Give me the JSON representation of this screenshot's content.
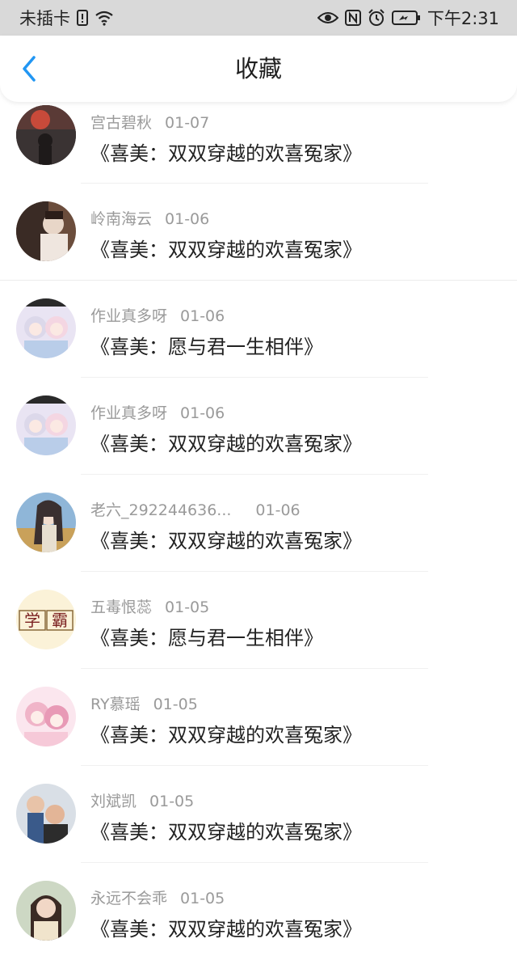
{
  "status_bar": {
    "carrier": "未插卡",
    "time": "下午2:31",
    "icons": [
      "sim-alert-icon",
      "wifi-icon",
      "eye-icon",
      "nfc-icon",
      "alarm-icon",
      "battery-icon"
    ]
  },
  "header": {
    "title": "收藏",
    "back_icon": "chevron-left-icon",
    "accent_color": "#2196f3"
  },
  "favorites": [
    {
      "user": "宫古碧秋",
      "date": "01-07",
      "title": "《喜美：双双穿越的欢喜冤家》"
    },
    {
      "user": "岭南海云",
      "date": "01-06",
      "title": "《喜美：双双穿越的欢喜冤家》"
    },
    {
      "user": "作业真多呀",
      "date": "01-06",
      "title": "《喜美：愿与君一生相伴》"
    },
    {
      "user": "作业真多呀",
      "date": "01-06",
      "title": "《喜美：双双穿越的欢喜冤家》"
    },
    {
      "user": "老六_292244636...",
      "date": "01-06",
      "title": "《喜美：双双穿越的欢喜冤家》"
    },
    {
      "user": "五毒恨蕊",
      "date": "01-05",
      "title": "《喜美：愿与君一生相伴》",
      "avatar_text": "学霸"
    },
    {
      "user": "RY慕瑶",
      "date": "01-05",
      "title": "《喜美：双双穿越的欢喜冤家》"
    },
    {
      "user": "刘斌凯",
      "date": "01-05",
      "title": "《喜美：双双穿越的欢喜冤家》"
    },
    {
      "user": "永远不会乖",
      "date": "01-05",
      "title": "《喜美：双双穿越的欢喜冤家》"
    }
  ]
}
